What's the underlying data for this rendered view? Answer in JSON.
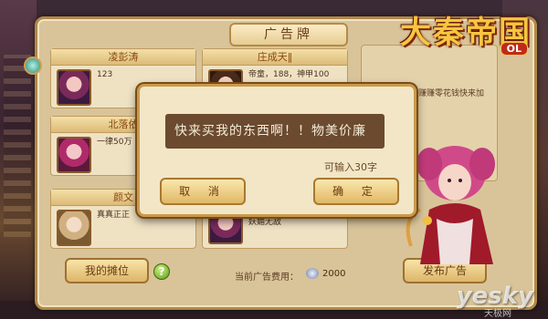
{
  "panel": {
    "title": "广告牌",
    "logo_text": "大秦帝国",
    "logo_badge": "OL"
  },
  "ads": [
    {
      "name": "凌彭涛",
      "text": "123"
    },
    {
      "name": "庄成天‖",
      "text": "帝童，188，神甲100"
    },
    {
      "name": "北落依",
      "text": "一律50万"
    },
    {
      "name": "颜文",
      "text": "真真正正"
    },
    {
      "name": "",
      "text": "妖媚无敌"
    }
  ],
  "side": {
    "text": "发发小广告，赚赚零花钱快来加入吧"
  },
  "bottom": {
    "stall_button": "我的摊位",
    "help_icon": "?",
    "fee_label": "当前广告费用：",
    "fee_value": "2000",
    "publish_button": "发布广告"
  },
  "dialog": {
    "message": "快来买我的东西啊！！物美价廉",
    "char_limit": "可输入30字",
    "cancel_button": "取 消",
    "confirm_button": "确 定"
  },
  "watermark": {
    "main": "yesky",
    "sub": "天极网"
  }
}
